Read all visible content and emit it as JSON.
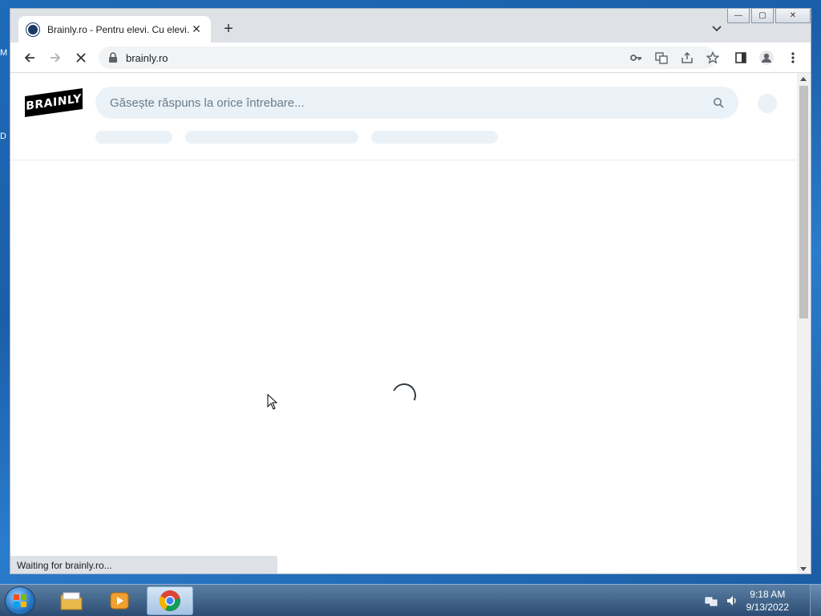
{
  "desktop": {
    "edge_glyphs": [
      "M",
      "D"
    ]
  },
  "window": {
    "caption": {
      "minimize": "—",
      "maximize": "▢",
      "close": "✕"
    }
  },
  "tab": {
    "title": "Brainly.ro - Pentru elevi. Cu elevi.",
    "close": "✕",
    "new_tab": "+"
  },
  "toolbar": {
    "url": "brainly.ro"
  },
  "page": {
    "logo_text": "BRAINLY",
    "search_placeholder": "Găsește răspuns la orice întrebare...",
    "status": "Waiting for brainly.ro..."
  },
  "taskbar": {
    "time": "9:18 AM",
    "date": "9/13/2022"
  },
  "colors": {
    "search_bg": "#ebf2f7",
    "brand": "#000000",
    "spinner": "#323c45"
  }
}
